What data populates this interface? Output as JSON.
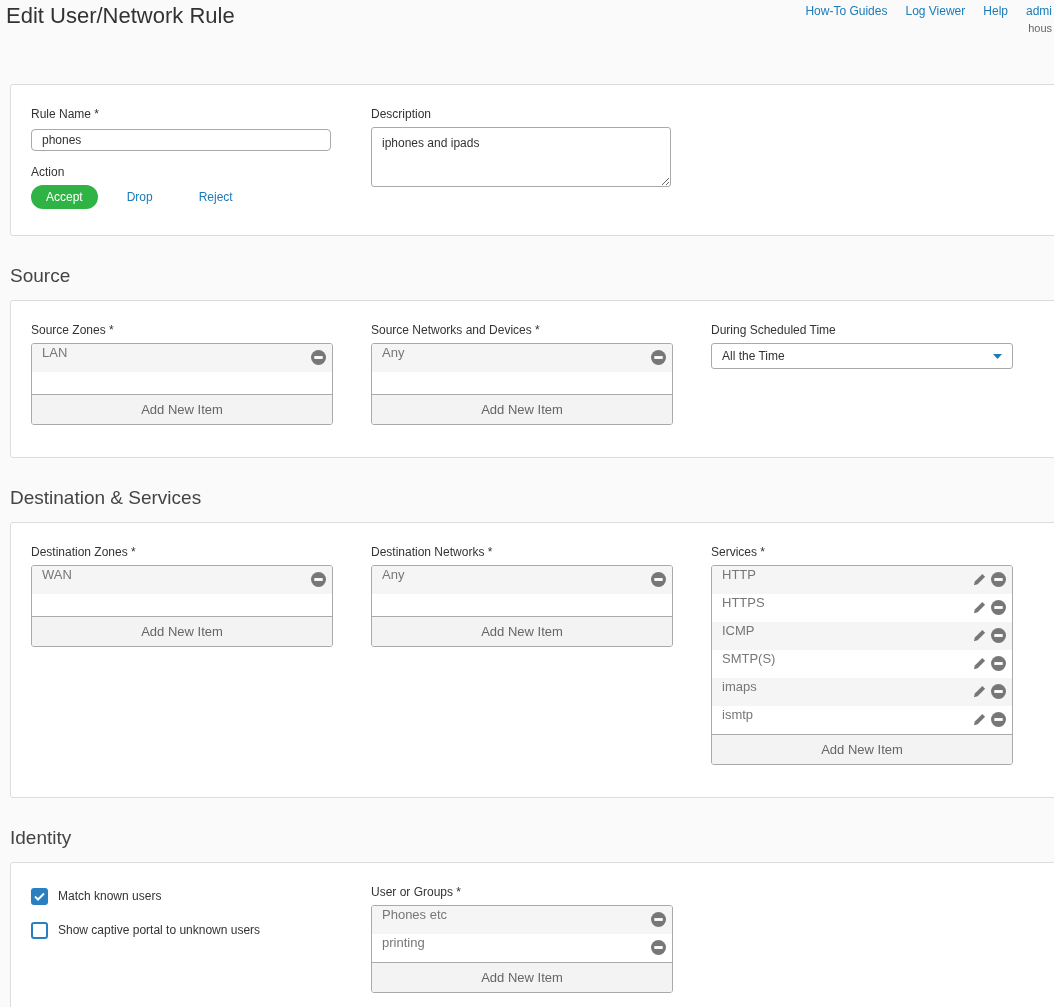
{
  "header": {
    "title": "Edit User/Network Rule",
    "links": [
      "How-To Guides",
      "Log Viewer",
      "Help",
      "admi"
    ],
    "user": "hous"
  },
  "rule": {
    "name_label": "Rule Name *",
    "name_value": "phones",
    "action_label": "Action",
    "actions": [
      {
        "label": "Accept",
        "selected": true
      },
      {
        "label": "Drop",
        "selected": false
      },
      {
        "label": "Reject",
        "selected": false
      }
    ],
    "description_label": "Description",
    "description_value": "iphones and ipads"
  },
  "sections": [
    {
      "heading": "Source",
      "fields": [
        {
          "kind": "list",
          "label": "Source Zones *",
          "items": [
            {
              "text": "LAN",
              "editable": false
            }
          ],
          "add": "Add New Item"
        },
        {
          "kind": "list",
          "label": "Source Networks and Devices *",
          "items": [
            {
              "text": "Any",
              "editable": false
            }
          ],
          "add": "Add New Item"
        },
        {
          "kind": "select",
          "label": "During Scheduled Time",
          "value": "All the Time"
        }
      ]
    },
    {
      "heading": "Destination & Services",
      "fields": [
        {
          "kind": "list",
          "label": "Destination Zones *",
          "items": [
            {
              "text": "WAN",
              "editable": false
            }
          ],
          "add": "Add New Item"
        },
        {
          "kind": "list",
          "label": "Destination Networks *",
          "items": [
            {
              "text": "Any",
              "editable": false
            }
          ],
          "add": "Add New Item"
        },
        {
          "kind": "list",
          "label": "Services *",
          "items": [
            {
              "text": "HTTP",
              "editable": true
            },
            {
              "text": "HTTPS",
              "editable": true
            },
            {
              "text": "ICMP",
              "editable": true
            },
            {
              "text": "SMTP(S)",
              "editable": true
            },
            {
              "text": "imaps",
              "editable": true
            },
            {
              "text": "ismtp",
              "editable": true
            }
          ],
          "add": "Add New Item"
        }
      ]
    },
    {
      "heading": "Identity",
      "fields": [
        {
          "kind": "checks",
          "options": [
            {
              "label": "Match known users",
              "checked": true
            },
            {
              "label": "Show captive portal to unknown users",
              "checked": false
            }
          ]
        },
        {
          "kind": "list",
          "label": "User or Groups *",
          "items": [
            {
              "text": "Phones etc",
              "editable": false
            },
            {
              "text": "printing",
              "editable": false
            }
          ],
          "add": "Add New Item"
        }
      ]
    }
  ]
}
